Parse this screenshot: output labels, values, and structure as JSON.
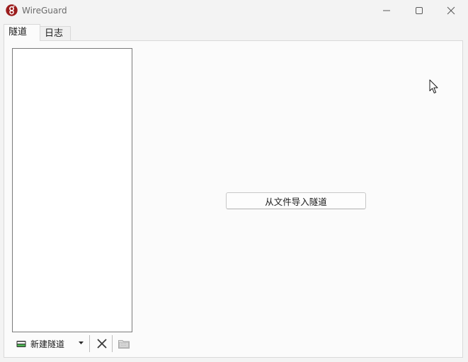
{
  "window": {
    "title": "WireGuard",
    "minimize_icon": "minimize-icon",
    "maximize_icon": "maximize-icon",
    "close_icon": "close-icon",
    "accent": "#9b1c1c"
  },
  "tabs": [
    {
      "label": "隧道",
      "active": true
    },
    {
      "label": "日志",
      "active": false
    }
  ],
  "tunnels": {
    "items": [],
    "toolbar": {
      "new_label": "新建隧道",
      "new_icon": "tunnel-add-icon",
      "dropdown_icon": "chevron-down-icon",
      "delete_icon": "close-x-icon",
      "export_icon": "export-zip-icon"
    }
  },
  "main": {
    "import_label": "从文件导入隧道"
  }
}
